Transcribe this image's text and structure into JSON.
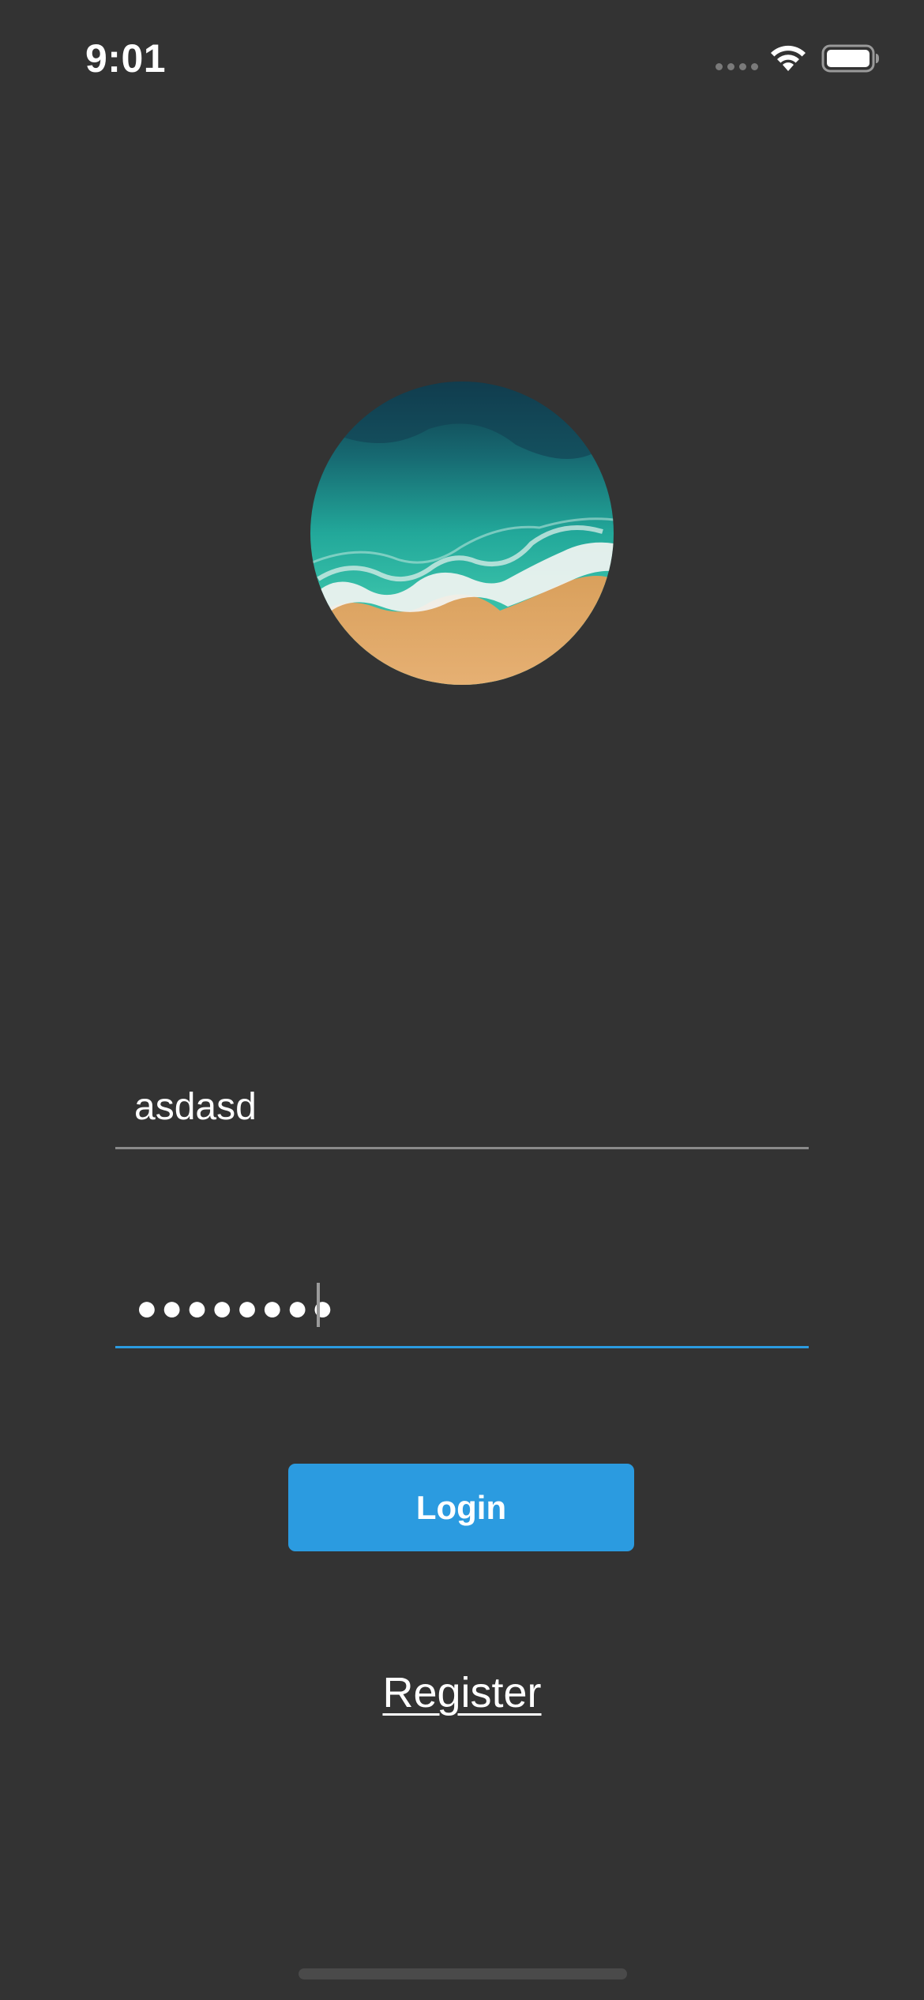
{
  "status_bar": {
    "time": "9:01",
    "signal_icon": "cellular-signal-icon",
    "wifi_icon": "wifi-icon",
    "battery_icon": "battery-icon"
  },
  "avatar": {
    "description_icon": "beach-avatar-image"
  },
  "login_form": {
    "username_value": "asdasd",
    "password_mask": "●●●●●●●●",
    "login_label": "Login",
    "register_label": "Register"
  },
  "colors": {
    "background": "#333333",
    "accent": "#2b9be0",
    "text": "#ffffff",
    "inactive_underline": "#8a8a8a"
  }
}
